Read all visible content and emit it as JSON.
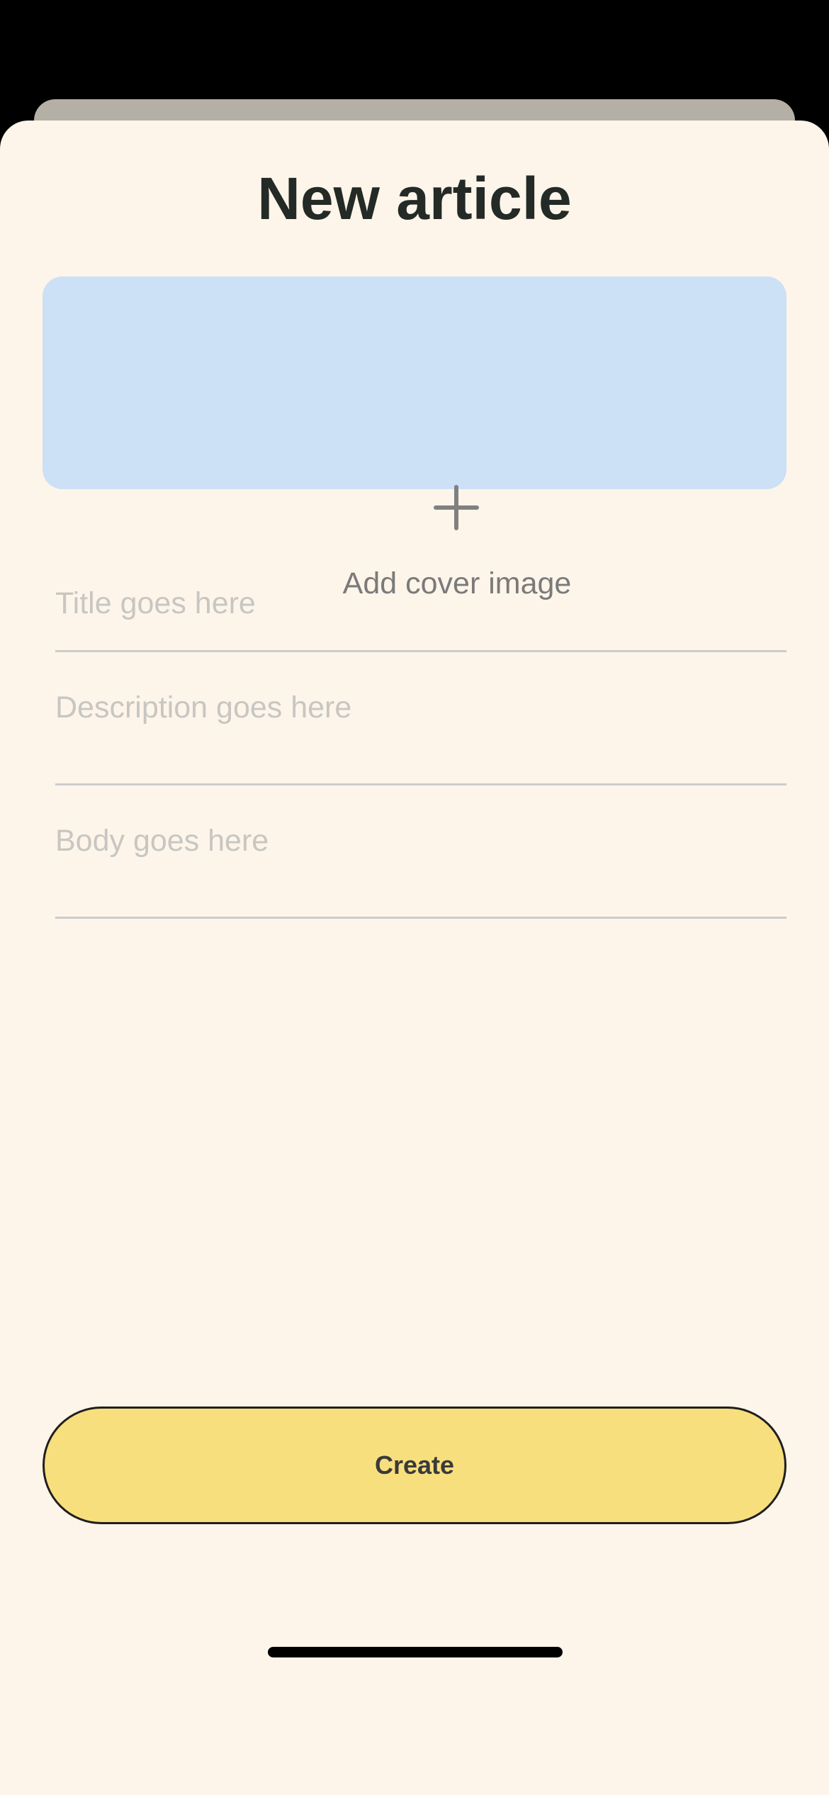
{
  "page": {
    "title": "New article"
  },
  "cover": {
    "icon": "plus-icon",
    "label": "Add cover image"
  },
  "fields": {
    "title": {
      "value": "",
      "placeholder": "Title goes here"
    },
    "description": {
      "value": "",
      "placeholder": "Description goes here"
    },
    "body": {
      "value": "",
      "placeholder": "Body goes here"
    }
  },
  "actions": {
    "create_label": "Create"
  },
  "colors": {
    "sheet_background": "#FDF5E9",
    "cover_background": "#CCE0F6",
    "button_background": "#F8DF7D",
    "title_text": "#242A26"
  }
}
